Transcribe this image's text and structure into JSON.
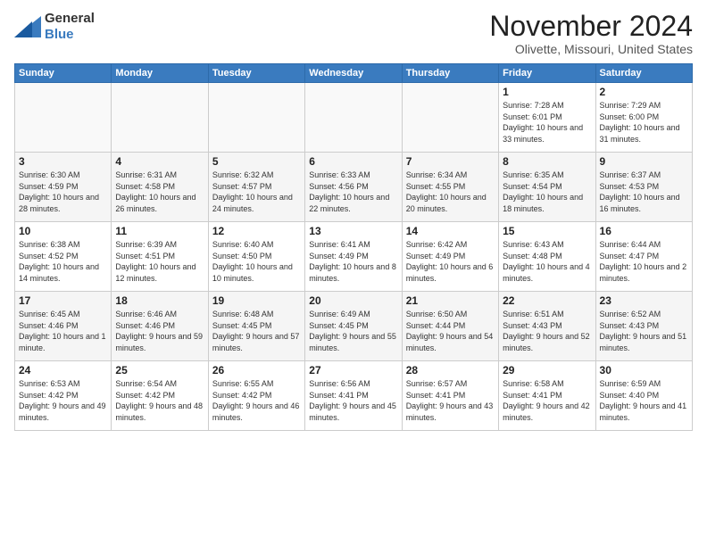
{
  "header": {
    "logo_general": "General",
    "logo_blue": "Blue",
    "month": "November 2024",
    "location": "Olivette, Missouri, United States"
  },
  "days_of_week": [
    "Sunday",
    "Monday",
    "Tuesday",
    "Wednesday",
    "Thursday",
    "Friday",
    "Saturday"
  ],
  "weeks": [
    [
      {
        "day": "",
        "info": ""
      },
      {
        "day": "",
        "info": ""
      },
      {
        "day": "",
        "info": ""
      },
      {
        "day": "",
        "info": ""
      },
      {
        "day": "",
        "info": ""
      },
      {
        "day": "1",
        "info": "Sunrise: 7:28 AM\nSunset: 6:01 PM\nDaylight: 10 hours and 33 minutes."
      },
      {
        "day": "2",
        "info": "Sunrise: 7:29 AM\nSunset: 6:00 PM\nDaylight: 10 hours and 31 minutes."
      }
    ],
    [
      {
        "day": "3",
        "info": "Sunrise: 6:30 AM\nSunset: 4:59 PM\nDaylight: 10 hours and 28 minutes."
      },
      {
        "day": "4",
        "info": "Sunrise: 6:31 AM\nSunset: 4:58 PM\nDaylight: 10 hours and 26 minutes."
      },
      {
        "day": "5",
        "info": "Sunrise: 6:32 AM\nSunset: 4:57 PM\nDaylight: 10 hours and 24 minutes."
      },
      {
        "day": "6",
        "info": "Sunrise: 6:33 AM\nSunset: 4:56 PM\nDaylight: 10 hours and 22 minutes."
      },
      {
        "day": "7",
        "info": "Sunrise: 6:34 AM\nSunset: 4:55 PM\nDaylight: 10 hours and 20 minutes."
      },
      {
        "day": "8",
        "info": "Sunrise: 6:35 AM\nSunset: 4:54 PM\nDaylight: 10 hours and 18 minutes."
      },
      {
        "day": "9",
        "info": "Sunrise: 6:37 AM\nSunset: 4:53 PM\nDaylight: 10 hours and 16 minutes."
      }
    ],
    [
      {
        "day": "10",
        "info": "Sunrise: 6:38 AM\nSunset: 4:52 PM\nDaylight: 10 hours and 14 minutes."
      },
      {
        "day": "11",
        "info": "Sunrise: 6:39 AM\nSunset: 4:51 PM\nDaylight: 10 hours and 12 minutes."
      },
      {
        "day": "12",
        "info": "Sunrise: 6:40 AM\nSunset: 4:50 PM\nDaylight: 10 hours and 10 minutes."
      },
      {
        "day": "13",
        "info": "Sunrise: 6:41 AM\nSunset: 4:49 PM\nDaylight: 10 hours and 8 minutes."
      },
      {
        "day": "14",
        "info": "Sunrise: 6:42 AM\nSunset: 4:49 PM\nDaylight: 10 hours and 6 minutes."
      },
      {
        "day": "15",
        "info": "Sunrise: 6:43 AM\nSunset: 4:48 PM\nDaylight: 10 hours and 4 minutes."
      },
      {
        "day": "16",
        "info": "Sunrise: 6:44 AM\nSunset: 4:47 PM\nDaylight: 10 hours and 2 minutes."
      }
    ],
    [
      {
        "day": "17",
        "info": "Sunrise: 6:45 AM\nSunset: 4:46 PM\nDaylight: 10 hours and 1 minute."
      },
      {
        "day": "18",
        "info": "Sunrise: 6:46 AM\nSunset: 4:46 PM\nDaylight: 9 hours and 59 minutes."
      },
      {
        "day": "19",
        "info": "Sunrise: 6:48 AM\nSunset: 4:45 PM\nDaylight: 9 hours and 57 minutes."
      },
      {
        "day": "20",
        "info": "Sunrise: 6:49 AM\nSunset: 4:45 PM\nDaylight: 9 hours and 55 minutes."
      },
      {
        "day": "21",
        "info": "Sunrise: 6:50 AM\nSunset: 4:44 PM\nDaylight: 9 hours and 54 minutes."
      },
      {
        "day": "22",
        "info": "Sunrise: 6:51 AM\nSunset: 4:43 PM\nDaylight: 9 hours and 52 minutes."
      },
      {
        "day": "23",
        "info": "Sunrise: 6:52 AM\nSunset: 4:43 PM\nDaylight: 9 hours and 51 minutes."
      }
    ],
    [
      {
        "day": "24",
        "info": "Sunrise: 6:53 AM\nSunset: 4:42 PM\nDaylight: 9 hours and 49 minutes."
      },
      {
        "day": "25",
        "info": "Sunrise: 6:54 AM\nSunset: 4:42 PM\nDaylight: 9 hours and 48 minutes."
      },
      {
        "day": "26",
        "info": "Sunrise: 6:55 AM\nSunset: 4:42 PM\nDaylight: 9 hours and 46 minutes."
      },
      {
        "day": "27",
        "info": "Sunrise: 6:56 AM\nSunset: 4:41 PM\nDaylight: 9 hours and 45 minutes."
      },
      {
        "day": "28",
        "info": "Sunrise: 6:57 AM\nSunset: 4:41 PM\nDaylight: 9 hours and 43 minutes."
      },
      {
        "day": "29",
        "info": "Sunrise: 6:58 AM\nSunset: 4:41 PM\nDaylight: 9 hours and 42 minutes."
      },
      {
        "day": "30",
        "info": "Sunrise: 6:59 AM\nSunset: 4:40 PM\nDaylight: 9 hours and 41 minutes."
      }
    ]
  ]
}
